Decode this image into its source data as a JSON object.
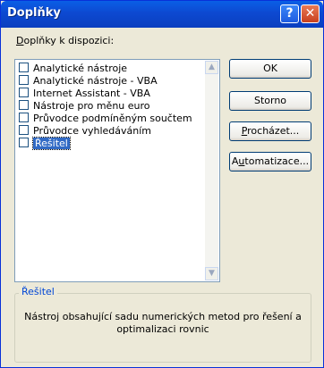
{
  "window": {
    "title": "Doplňky",
    "help_glyph": "?",
    "close_glyph": "✕"
  },
  "list": {
    "label_underlined": "D",
    "label_rest": "oplňky k dispozici:",
    "items": [
      {
        "label": "Analytické nástroje",
        "checked": false,
        "selected": false
      },
      {
        "label": "Analytické nástroje - VBA",
        "checked": false,
        "selected": false
      },
      {
        "label": "Internet Assistant - VBA",
        "checked": false,
        "selected": false
      },
      {
        "label": "Nástroje pro měnu euro",
        "checked": false,
        "selected": false
      },
      {
        "label": "Průvodce podmíněným součtem",
        "checked": false,
        "selected": false
      },
      {
        "label": "Průvodce vyhledáváním",
        "checked": false,
        "selected": false
      },
      {
        "label": "Řešitel",
        "checked": false,
        "selected": true
      }
    ]
  },
  "buttons": {
    "ok": "OK",
    "storno": "Storno",
    "browse_ul": "P",
    "browse_rest": "rocházet...",
    "auto_pre": "A",
    "auto_ul": "u",
    "auto_rest": "tomatizace..."
  },
  "details": {
    "title": "Řešitel",
    "description": "Nástroj obsahující sadu numerických metod pro řešení a optimalizaci rovnic"
  },
  "colors": {
    "selection": "#316AC5",
    "title_bar": "#0B4FD6",
    "legend_text": "#0046D5"
  }
}
